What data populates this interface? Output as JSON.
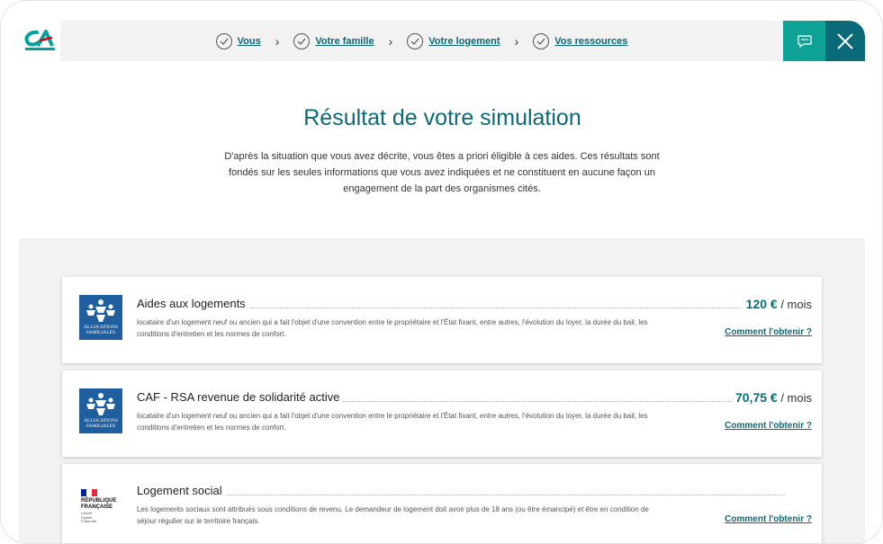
{
  "header": {
    "logo_name": "credit-agricole-logo",
    "steps": [
      {
        "label": "Vous"
      },
      {
        "label": "Votre famille"
      },
      {
        "label": "Votre logement"
      },
      {
        "label": "Vos ressources"
      }
    ],
    "chat_icon": "chat-bubble-icon",
    "close_icon": "close-icon"
  },
  "main": {
    "title": "Résultat de votre simulation",
    "intro": "D'après la situation que vous avez décrite, vous êtes a priori éligible à ces aides. Ces résultats sont fondés sur les seules informations que vous avez indiquées et ne constituent en aucune façon un engagement de la part des organismes cités."
  },
  "results": [
    {
      "name": "Aides aux logements",
      "amount": "120 €",
      "unit": "/ mois",
      "description": "locataire d'un logement neuf ou ancien qui a fait l'objet d'une convention entre le propriétaire et l'État fixant, entre autres, l'évolution du loyer, la durée du bail, les conditions d'entretien et les normes de confort.",
      "link": "Comment l'obtenir ?",
      "logo_text": [
        "ALLOCATIONS",
        "FAMILIALES"
      ]
    },
    {
      "name": "CAF - RSA revenue de solidarité active",
      "amount": "70,75 €",
      "unit": "/ mois",
      "description": "locataire d'un logement neuf ou ancien qui a fait l'objet d'une convention entre le propriétaire et l'État fixant, entre autres, l'évolution du loyer, la durée du bail, les conditions d'entretien et les normes de confort.",
      "link": "Comment l'obtenir ?",
      "logo_text": [
        "ALLOCATIONS",
        "FAMILIALES"
      ]
    },
    {
      "name": "Logement social",
      "amount": "",
      "unit": "",
      "description": "Les logements sociaux sont attribués sous conditions de revenu. Le demandeur de logement doit avoir plus de 18 ans (ou être émancipé) et être en condition de séjour régulier sur le territoire français.",
      "link": "Comment l'obtenir ?",
      "logo_text": [
        "RÉPUBLIQUE",
        "FRANÇAISE"
      ],
      "logo_motto": [
        "Liberté",
        "Égalité",
        "Fraternité"
      ]
    }
  ],
  "colors": {
    "teal_dark": "#0b6a78",
    "teal_light": "#0fa397",
    "caf_blue": "#1f5f9f",
    "logo_green": "#00a19a",
    "logo_red": "#e2001a"
  }
}
